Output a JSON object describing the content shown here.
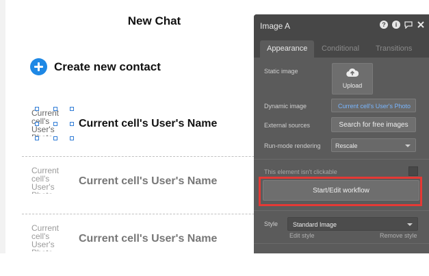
{
  "page": {
    "title": "New Chat",
    "create_label": "Create new contact",
    "rows": [
      {
        "photo": "Current cell's User's Photo",
        "name": "Current cell's User's Name"
      },
      {
        "photo": "Current cell's User's Photo",
        "name": "Current cell's User's Name"
      },
      {
        "photo": "Current cell's User's Photo",
        "name": "Current cell's User's Name"
      }
    ]
  },
  "panel": {
    "title": "Image A",
    "header_icons": [
      "help-icon",
      "info-icon",
      "comment-icon",
      "close-icon"
    ],
    "tabs": [
      "Appearance",
      "Conditional",
      "Transitions"
    ],
    "static_image_label": "Static image",
    "upload_label": "Upload",
    "dynamic_image_label": "Dynamic image",
    "dynamic_image_value": "Current cell's User's Photo",
    "external_sources_label": "External sources",
    "search_button": "Search for free images",
    "run_mode_label": "Run-mode rendering",
    "run_mode_value": "Rescale",
    "clickable_label": "This element isn't clickable",
    "workflow_button": "Start/Edit workflow",
    "style_label": "Style",
    "style_value": "Standard Image",
    "edit_style": "Edit style",
    "remove_style": "Remove style"
  },
  "colors": {
    "accent_blue": "#1e88e5",
    "highlight_red": "#e53935",
    "panel_bg": "#5b5b5b",
    "link_blue": "#79b6ff"
  }
}
